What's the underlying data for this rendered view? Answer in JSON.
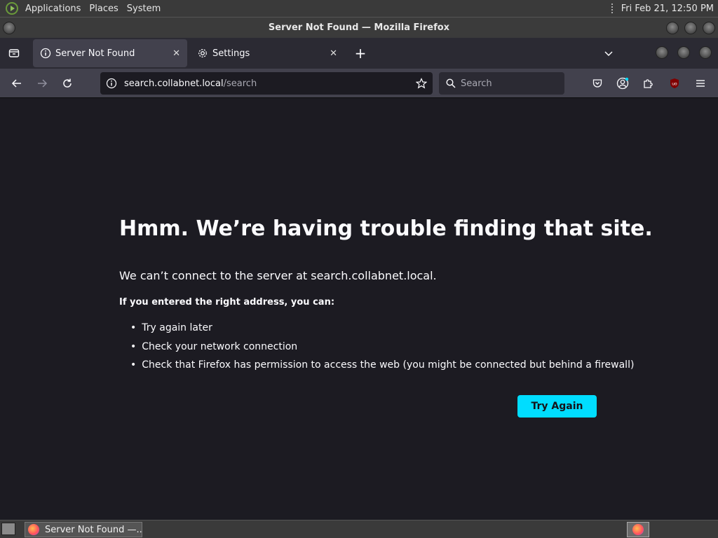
{
  "top_panel": {
    "menus": [
      "Applications",
      "Places",
      "System"
    ],
    "clock": "Fri Feb 21, 12:50 PM"
  },
  "window": {
    "title": "Server Not Found — Mozilla Firefox"
  },
  "tabs": [
    {
      "label": "Server Not Found",
      "icon": "info-icon",
      "active": true
    },
    {
      "label": "Settings",
      "icon": "gear-icon",
      "active": false
    }
  ],
  "navbar": {
    "url_host": "search.collabnet.local",
    "url_path": "/search",
    "search_placeholder": "Search"
  },
  "error_page": {
    "title": "Hmm. We’re having trouble finding that site.",
    "description": "We can’t connect to the server at search.collabnet.local.",
    "subheading": "If you entered the right address, you can:",
    "suggestions": [
      "Try again later",
      "Check your network connection",
      "Check that Firefox has permission to access the web (you might be connected but behind a firewall)"
    ],
    "button_label": "Try Again",
    "button_color": "#00ddff"
  },
  "taskbar": {
    "task_label": "Server Not Found —..."
  },
  "colors": {
    "page_bg": "#1c1b22",
    "toolbar_bg": "#42414d",
    "tabstrip_bg": "#2b2a33"
  }
}
